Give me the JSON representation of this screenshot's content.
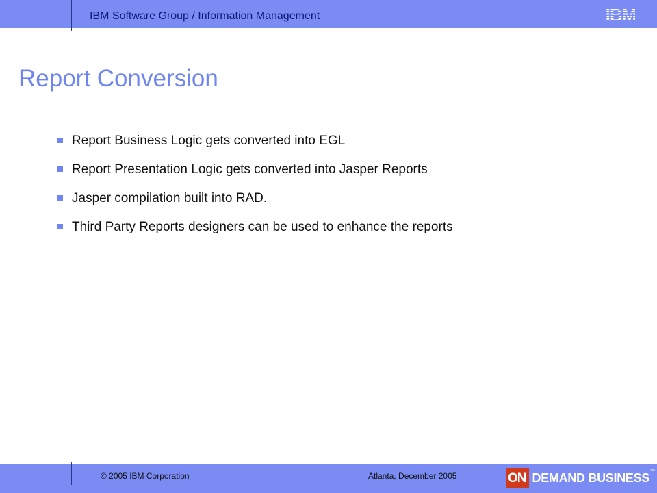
{
  "header": {
    "title": "IBM Software Group / Information Management",
    "logo": "IBM"
  },
  "slide": {
    "title": "Report Conversion",
    "bullets": [
      "Report Business Logic gets converted into EGL",
      "Report Presentation Logic gets converted into Jasper Reports",
      "Jasper compilation built into RAD.",
      "Third Party Reports designers can be used to enhance the reports"
    ]
  },
  "footer": {
    "copyright": "© 2005 IBM Corporation",
    "event": "Atlanta, December 2005",
    "logo_on": "ON",
    "logo_text": "DEMAND BUSINESS",
    "logo_tm": "™"
  },
  "colors": {
    "bar": "#7a8cf3",
    "title": "#6f86f0",
    "logo_red": "#d23a1e"
  }
}
